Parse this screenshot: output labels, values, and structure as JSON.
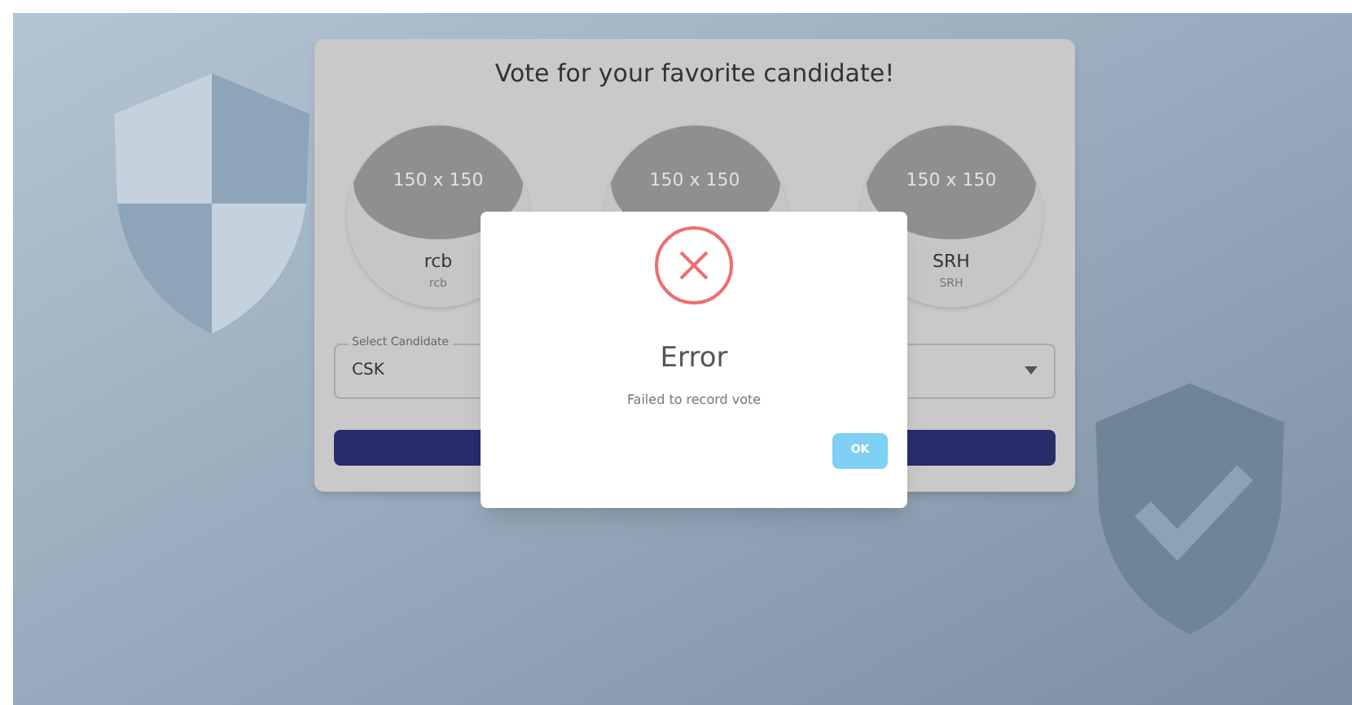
{
  "card": {
    "title": "Vote for your favorite candidate!",
    "candidates": [
      {
        "image_text": "150 x 150",
        "name": "rcb",
        "subtitle": "rcb"
      },
      {
        "image_text": "150 x 150"
      },
      {
        "image_text": "150 x 150",
        "name": "SRH",
        "subtitle": "SRH"
      }
    ],
    "select": {
      "label": "Select Candidate",
      "value": "CSK"
    }
  },
  "dialog": {
    "title": "Error",
    "message": "Failed to record vote",
    "button": "OK"
  }
}
